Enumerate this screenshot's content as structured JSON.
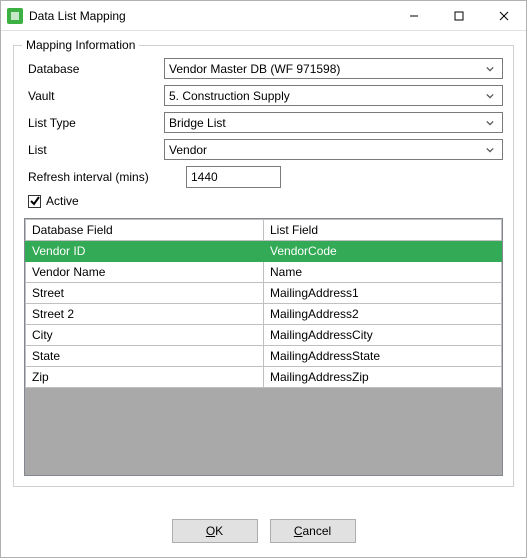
{
  "window": {
    "title": "Data List Mapping"
  },
  "group": {
    "legend": "Mapping Information"
  },
  "labels": {
    "database": "Database",
    "vault": "Vault",
    "list_type": "List Type",
    "list": "List",
    "refresh": "Refresh interval (mins)",
    "active": "Active"
  },
  "values": {
    "database": "Vendor Master DB (WF 971598)",
    "vault": "5. Construction Supply",
    "list_type": "Bridge List",
    "list": "Vendor",
    "refresh": "1440",
    "active": true
  },
  "table": {
    "headers": {
      "db_field": "Database Field",
      "list_field": "List Field"
    },
    "rows": [
      {
        "db": "Vendor ID",
        "list": "VendorCode",
        "selected": true
      },
      {
        "db": "Vendor Name",
        "list": "Name",
        "selected": false
      },
      {
        "db": "Street",
        "list": "MailingAddress1",
        "selected": false
      },
      {
        "db": "Street 2",
        "list": "MailingAddress2",
        "selected": false
      },
      {
        "db": "City",
        "list": "MailingAddressCity",
        "selected": false
      },
      {
        "db": "State",
        "list": "MailingAddressState",
        "selected": false
      },
      {
        "db": "Zip",
        "list": "MailingAddressZip",
        "selected": false
      }
    ]
  },
  "buttons": {
    "ok": "OK",
    "ok_u": "O",
    "ok_rest": "K",
    "cancel": "Cancel",
    "cancel_u": "C",
    "cancel_rest": "ancel"
  }
}
